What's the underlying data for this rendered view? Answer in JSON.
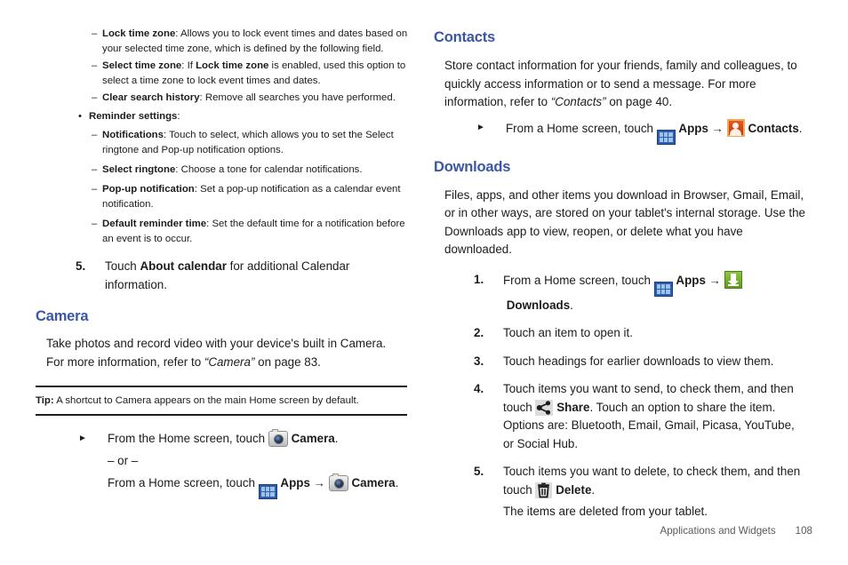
{
  "colors": {
    "heading": "#3a56a5",
    "text": "#1c1c1c",
    "footer": "#58595b",
    "apps_icon": "#2a5fad",
    "contacts_icon": "#c23a12",
    "downloads_icon": "#5e9a1e"
  },
  "left_column": {
    "dash_items": [
      {
        "marker": "–",
        "term": "Lock time zone",
        "text": ": Allows you to lock event times and dates based on your selected time zone, which is defined by the following field."
      },
      {
        "marker": "–",
        "term": "Select time zone",
        "text_before": ": If ",
        "term2": "Lock time zone",
        "text": " is enabled, used this option to select a time zone to lock event times and dates."
      },
      {
        "marker": "–",
        "term": "Clear search history",
        "text": ": Remove all searches you have performed."
      }
    ],
    "bullet_item": {
      "marker": "•",
      "term": "Reminder settings",
      "text": ":"
    },
    "sub_dash_items": [
      {
        "marker": "–",
        "term": "Notifications",
        "text": ": Touch to select, which allows you to set the Select ringtone and Pop-up notification options."
      },
      {
        "marker": "–",
        "term": "Select ringtone",
        "text": ": Choose a tone for calendar notifications."
      },
      {
        "marker": "–",
        "term": "Pop-up notification",
        "text": ": Set a pop-up notification as a calendar event notification."
      },
      {
        "marker": "–",
        "term": "Default reminder time",
        "text": ": Set the default time for a notification before an event is to occur."
      }
    ],
    "step5": {
      "marker": "5.",
      "text_before": "Touch ",
      "term": "About calendar",
      "text_after": " for additional Calendar information."
    },
    "camera": {
      "heading": "Camera",
      "paragraph": "Take photos and record video with your device's built in Camera. For more information, refer to ",
      "paragraph_ref": "“Camera”",
      "paragraph_tail": " on page 83.",
      "tip_label": "Tip:",
      "tip_text": " A shortcut to Camera appears on the main Home screen by default.",
      "step_marker": "►",
      "step_text_1": "From the Home screen, touch ",
      "step_label_1": "Camera",
      "step_period_1": ".",
      "or_text": "– or –",
      "step_text_2": "From a Home screen, touch ",
      "apps_label": "Apps",
      "arrow": "→",
      "step_label_2": "Camera",
      "step_period_2": "."
    }
  },
  "right_column": {
    "contacts": {
      "heading": "Contacts",
      "paragraph": "Store contact information for your friends, family and colleagues, to quickly access information or to send a message. For more information, refer to ",
      "paragraph_ref": "“Contacts”",
      "paragraph_tail": " on page 40.",
      "step_marker": "►",
      "step_text": "From a Home screen, touch ",
      "apps_label": "Apps",
      "arrow": "→",
      "step_label": "Contacts",
      "step_period": "."
    },
    "downloads": {
      "heading": "Downloads",
      "paragraph": "Files, apps, and other items you download in Browser, Gmail, Email, or in other ways, are stored on your tablet's internal storage. Use the Downloads app to view, reopen, or delete what you have downloaded.",
      "steps": [
        {
          "marker": "1.",
          "text": "From a Home screen, touch ",
          "apps_label": "Apps",
          "arrow": "→",
          "label": "Downloads",
          "period": "."
        },
        {
          "marker": "2.",
          "text": "Touch an item to open it."
        },
        {
          "marker": "3.",
          "text": "Touch headings for earlier downloads to view them."
        },
        {
          "marker": "4.",
          "text": "Touch items you want to send, to check them, and then touch ",
          "label": "Share",
          "tail": ". Touch an option to share the item. Options are: Bluetooth, Email, Gmail, Picasa, YouTube, or Social Hub."
        },
        {
          "marker": "5.",
          "text": "Touch items you want to delete, to check them, and then touch ",
          "label": "Delete",
          "tail": "."
        }
      ],
      "closing_text": "The items are deleted from your tablet."
    }
  },
  "footer": {
    "chapter": "Applications and Widgets",
    "page_number": "108"
  }
}
